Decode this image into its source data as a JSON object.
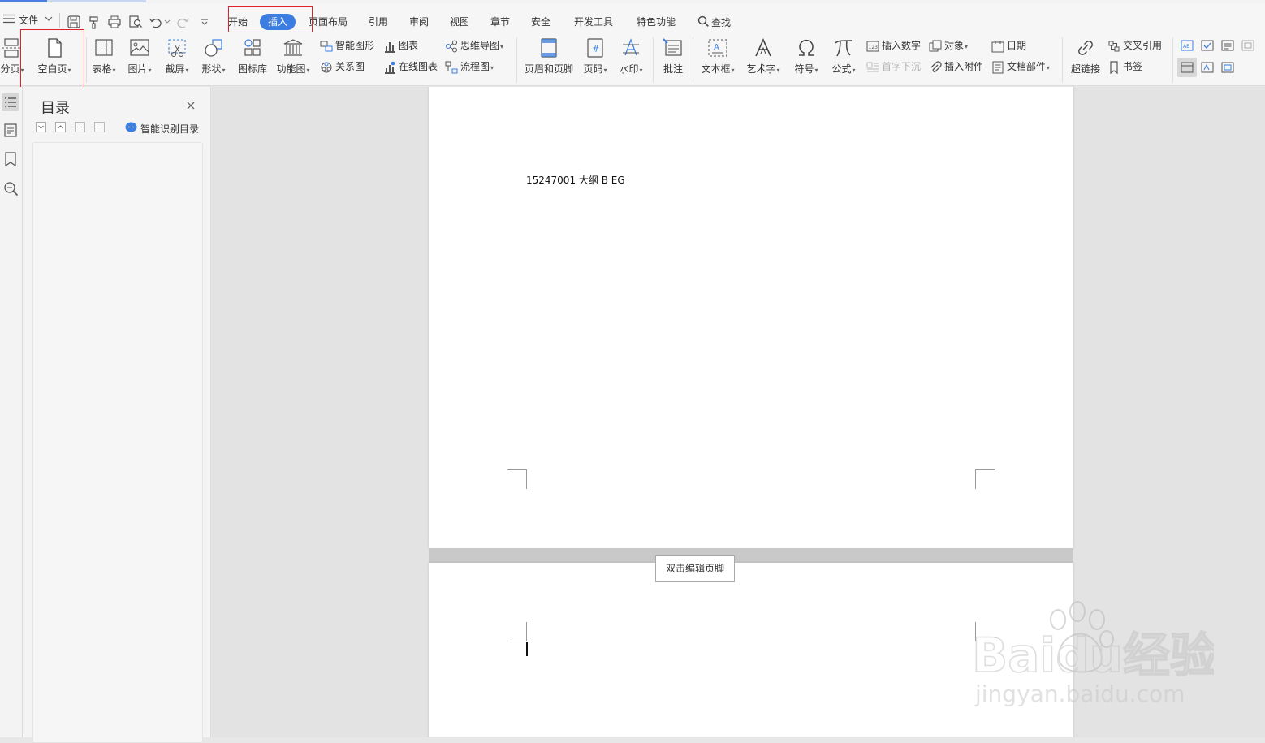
{
  "menubar": {
    "file_label": "文件",
    "tabs": [
      "开始",
      "插入",
      "页面布局",
      "引用",
      "审阅",
      "视图",
      "章节",
      "安全",
      "开发工具",
      "特色功能"
    ],
    "active_tab": "插入",
    "search_label": "查找"
  },
  "ribbon": {
    "page_break": "分页",
    "blank_page": "空白页",
    "table": "表格",
    "picture": "图片",
    "screenshot": "截屏",
    "shapes": "形状",
    "icon_library": "图标库",
    "function_chart": "功能图",
    "smart_shape": "智能图形",
    "chart": "图表",
    "mind_map": "思维导图",
    "relation_chart": "关系图",
    "online_chart": "在线图表",
    "flowchart": "流程图",
    "header_footer": "页眉和页脚",
    "page_number": "页码",
    "watermark": "水印",
    "comment": "批注",
    "text_box": "文本框",
    "word_art": "艺术字",
    "symbol": "符号",
    "formula": "公式",
    "insert_number": "插入数字",
    "object": "对象",
    "date": "日期",
    "drop_cap": "首字下沉",
    "insert_attachment": "插入附件",
    "doc_parts": "文档部件",
    "hyperlink": "超链接",
    "cross_reference": "交叉引用",
    "bookmark": "书签"
  },
  "toc": {
    "title": "目录",
    "smart_toc": "智能识别目录"
  },
  "document": {
    "page1_text": "15247001 大纲 B EG",
    "footer_tip": "双击编辑页脚"
  },
  "watermark": {
    "brand": "Baidu经验",
    "url": "jingyan.baidu.com"
  },
  "colors": {
    "accent": "#3b7de0",
    "highlight_box": "#e0202a"
  }
}
